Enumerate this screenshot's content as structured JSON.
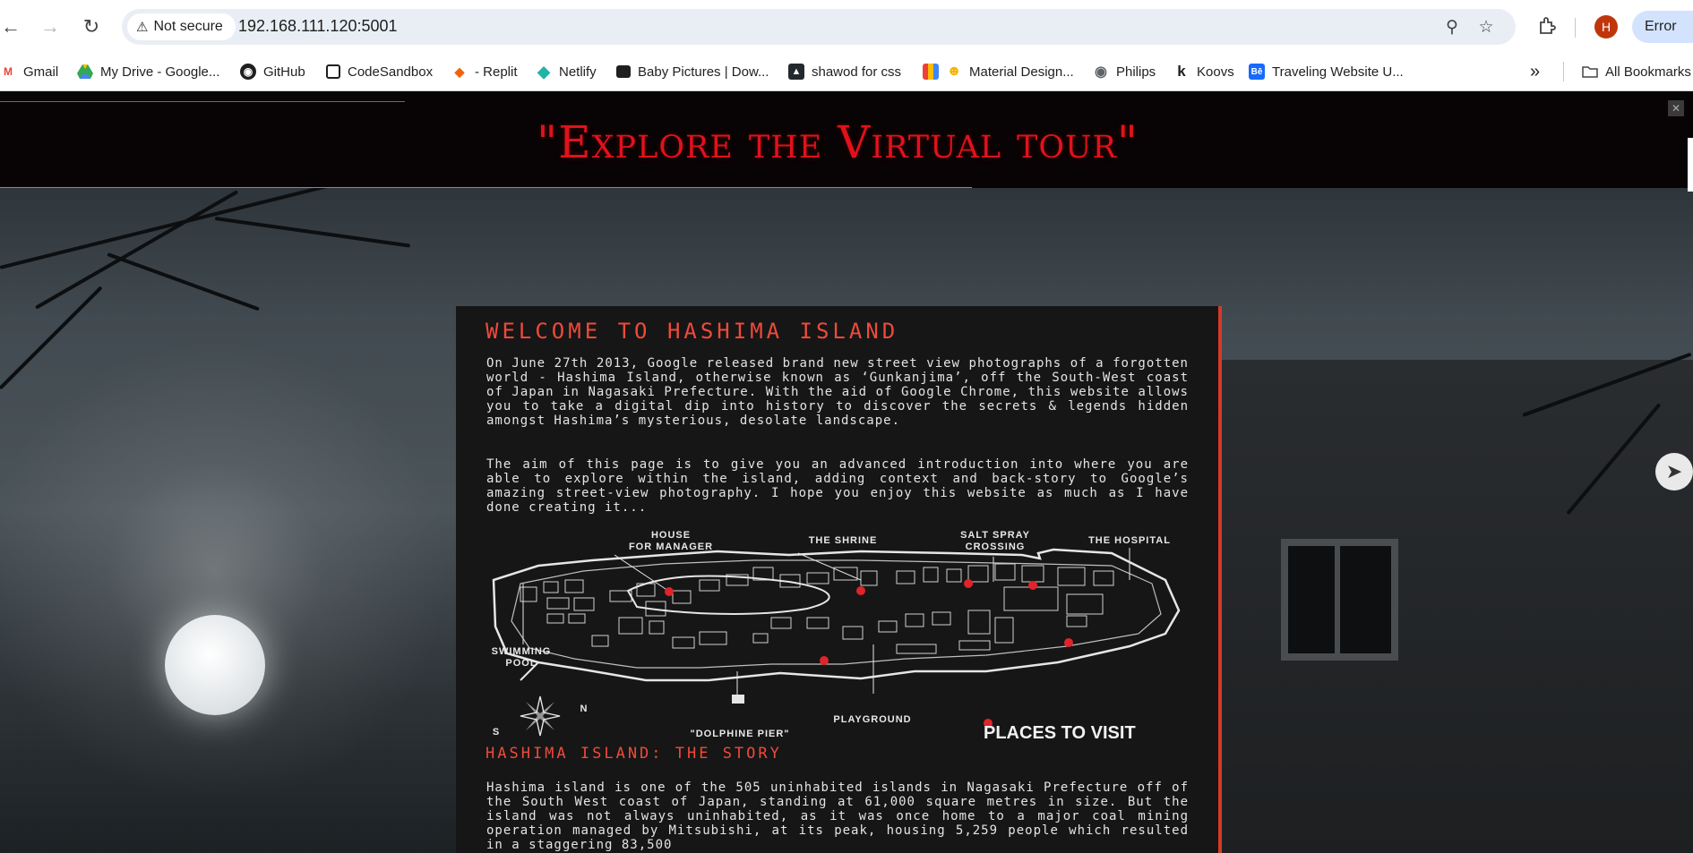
{
  "browser": {
    "security_label": "Not secure",
    "url": "192.168.111.120:5001",
    "profile_initial": "H",
    "error_label": "Error",
    "icons": [
      "back-arrow-icon",
      "forward-arrow-icon",
      "reload-icon",
      "warning-icon",
      "zoom-icon",
      "star-icon",
      "extensions-icon",
      "chevron-double-right-icon",
      "folder-icon"
    ]
  },
  "bookmarks": [
    {
      "label": "Gmail",
      "icon": "gmail-icon"
    },
    {
      "label": "My Drive - Google...",
      "icon": "drive-icon"
    },
    {
      "label": "GitHub",
      "icon": "github-icon"
    },
    {
      "label": "CodeSandbox",
      "icon": "codesandbox-icon"
    },
    {
      "label": "- Replit",
      "icon": "replit-icon"
    },
    {
      "label": "Netlify",
      "icon": "netlify-icon"
    },
    {
      "label": "Baby Pictures | Dow...",
      "icon": "unsplash-icon"
    },
    {
      "label": "shawod for css",
      "icon": "shadow-icon"
    },
    {
      "label": "Material Design...",
      "icon": "material-icon"
    },
    {
      "label": "Philips",
      "icon": "globe-icon"
    },
    {
      "label": "Koovs",
      "icon": "koovs-icon"
    },
    {
      "label": "Traveling Website U...",
      "icon": "behance-icon"
    }
  ],
  "all_bookmarks_label": "All Bookmarks",
  "page": {
    "banner_title": "\"Explore the Virtual tour\"",
    "welcome_title": "WELCOME TO HASHIMA ISLAND",
    "intro_paragraph": "On June 27th 2013, Google released brand new street view photographs of a forgotten world - Hashima Island, otherwise known as ‘Gunkanjima’, off the South-West coast of Japan in Nagasaki Prefecture. With the aid of Google Chrome, this website allows you to take a digital dip into history to discover the secrets & legends hidden amongst Hashima’s mysterious, desolate landscape.",
    "aim_paragraph": "The aim of this page is to give you an advanced introduction into where you are able to explore within the island, adding context and back-story to Google’s amazing street-view photography. I hope you enjoy this website as much as I have done creating it...",
    "story_title": "HASHIMA ISLAND: THE STORY",
    "story_paragraph": "Hashima island is one of the 505 uninhabited islands in Nagasaki Prefecture off of the South West coast of Japan, standing at 61,000 square metres in size. But the island was not always uninhabited, as it was once home to a major coal mining operation managed by Mitsubishi, at its peak, housing 5,259 people which resulted in a staggering 83,500"
  },
  "map": {
    "labels": {
      "house_for_manager": "HOUSE\nFOR MANAGER",
      "shrine": "THE SHRINE",
      "salt_spray": "SALT SPRAY\nCROSSING",
      "hospital": "THE HOSPITAL",
      "swimming_pool": "SWIMMING\nPOOL",
      "dolphine_pier": "\"DOLPHINE PIER\"",
      "playground": "PLAYGROUND",
      "compass_s": "S",
      "compass_n": "N",
      "legend": "PLACES TO VISIT"
    },
    "colors": {
      "marker": "#e0242a",
      "accent": "#ef4a3b"
    }
  }
}
